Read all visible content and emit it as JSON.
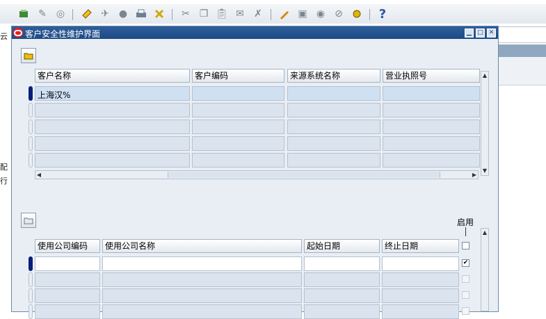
{
  "window": {
    "title": "客户安全性维护界面"
  },
  "background": {
    "edge_chars": [
      "云",
      "配",
      "行"
    ]
  },
  "toolbar": {
    "icons": [
      "new-icon",
      "find-icon",
      "navigator-icon",
      "save-icon",
      "next-step-icon",
      "switch-icon",
      "print-icon",
      "close-form-icon",
      "cut-icon",
      "copy-icon",
      "paste-icon",
      "new-record-icon",
      "delete-record-icon",
      "edit-field-icon",
      "zoom-icon",
      "translations-icon",
      "attachments-icon",
      "folder-tools-icon",
      "help-icon"
    ],
    "help_glyph": "?"
  },
  "customer_table": {
    "columns": [
      "客户名称",
      "客户编码",
      "来源系统名称",
      "营业执照号"
    ],
    "rows": [
      [
        "上海汉%",
        "",
        "",
        ""
      ],
      [
        "",
        "",
        "",
        ""
      ],
      [
        "",
        "",
        "",
        ""
      ],
      [
        "",
        "",
        "",
        ""
      ],
      [
        "",
        "",
        "",
        ""
      ]
    ]
  },
  "company_table": {
    "columns": [
      "使用公司编码",
      "使用公司名称",
      "起始日期",
      "终止日期"
    ],
    "enable_label": "启用",
    "rows": [
      {
        "cells": [
          "",
          "",
          "",
          ""
        ],
        "enabled": true
      },
      {
        "cells": [
          "",
          "",
          "",
          ""
        ],
        "enabled": false
      },
      {
        "cells": [
          "",
          "",
          "",
          ""
        ],
        "enabled": false
      },
      {
        "cells": [
          "",
          "",
          "",
          ""
        ],
        "enabled": false
      }
    ]
  },
  "colors": {
    "titlebar": "#1d4a85",
    "form_bg": "#e9eef4",
    "field_bg": "#dbe4ee",
    "current_row_marker": "#0a1f7a"
  }
}
